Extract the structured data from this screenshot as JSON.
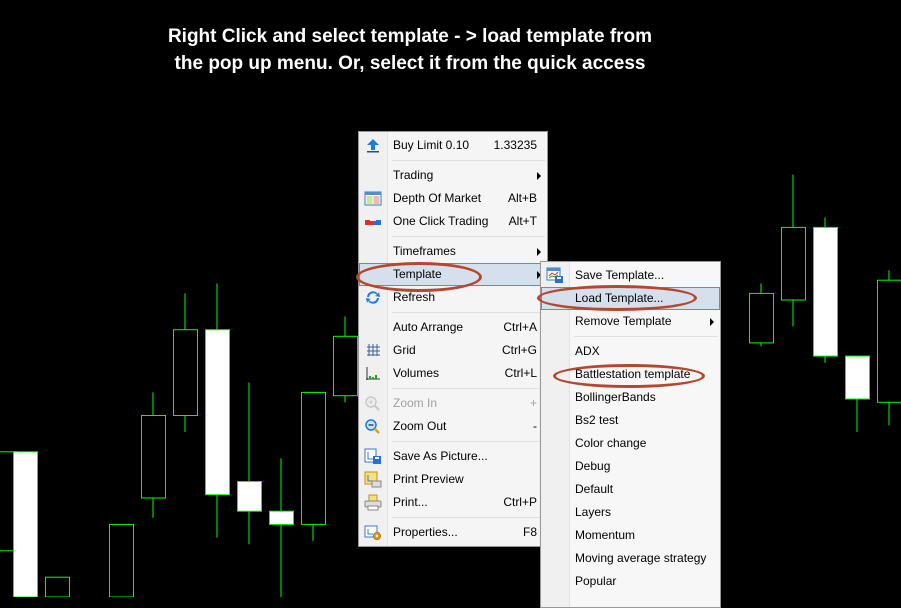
{
  "caption": {
    "line1": "Right Click and select template - > load template from",
    "line2": "the pop up menu. Or, select it from the quick access"
  },
  "colors": {
    "background": "#000000",
    "candle_outline": "#00ff00",
    "bull_fill": "#000000",
    "bear_fill": "#ffffff",
    "highlight_ellipse": "#b5472e",
    "menu_highlight": "#d5e0ec"
  },
  "chart_data": {
    "type": "candlestick",
    "title": "",
    "note": "Price values are relative (no axis shown); y in relative units, higher = higher price",
    "candles": [
      {
        "o": 44,
        "c": 14,
        "h": 44,
        "l": 14,
        "kind": "bull"
      },
      {
        "o": 44,
        "c": 0,
        "h": 44,
        "l": 0,
        "kind": "bear"
      },
      {
        "o": 6,
        "c": 0,
        "h": 6,
        "l": 0,
        "kind": "bull"
      },
      {
        "o": 22,
        "c": 0,
        "h": 22,
        "l": 0,
        "kind": "bull"
      },
      {
        "o": 55,
        "c": 30,
        "h": 62,
        "l": 24,
        "kind": "bull"
      },
      {
        "o": 81,
        "c": 55,
        "h": 92,
        "l": 50,
        "kind": "bull"
      },
      {
        "o": 81,
        "c": 31,
        "h": 95,
        "l": 18,
        "kind": "bear"
      },
      {
        "o": 35,
        "c": 26,
        "h": 65,
        "l": 16,
        "kind": "bear"
      },
      {
        "o": 26,
        "c": 22,
        "h": 42,
        "l": 0,
        "kind": "bear"
      },
      {
        "o": 62,
        "c": 22,
        "h": 62,
        "l": 17,
        "kind": "bull"
      },
      {
        "o": 79,
        "c": 61,
        "h": 85,
        "l": 59,
        "kind": "bull"
      },
      {
        "o": 85,
        "c": 74,
        "h": 89,
        "l": 71,
        "kind": "bull"
      },
      {
        "o": 93,
        "c": 72,
        "h": 98,
        "l": 69,
        "kind": "bull"
      },
      {
        "o": 72,
        "c": 60,
        "h": 73,
        "l": 57,
        "kind": "bull"
      },
      {
        "o": 92,
        "c": 77,
        "h": 95,
        "l": 76,
        "kind": "bull"
      },
      {
        "o": 112,
        "c": 90,
        "h": 128,
        "l": 82,
        "kind": "bull"
      },
      {
        "o": 112,
        "c": 73,
        "h": 115,
        "l": 71,
        "kind": "bear"
      },
      {
        "o": 73,
        "c": 60,
        "h": 73,
        "l": 50,
        "kind": "bear"
      },
      {
        "o": 96,
        "c": 59,
        "h": 99,
        "l": 52,
        "kind": "bull"
      }
    ]
  },
  "main_menu": {
    "items": [
      {
        "type": "item",
        "icon": "buy-limit-up-arrow-icon",
        "label": "Buy Limit 0.10",
        "shortcut": "1.33235"
      },
      {
        "type": "sep"
      },
      {
        "type": "item",
        "icon": "",
        "label": "Trading",
        "submenu": true
      },
      {
        "type": "item",
        "icon": "depth-of-market-icon",
        "label": "Depth Of Market",
        "shortcut": "Alt+B"
      },
      {
        "type": "item",
        "icon": "one-click-trading-icon",
        "label": "One Click Trading",
        "shortcut": "Alt+T"
      },
      {
        "type": "sep"
      },
      {
        "type": "item",
        "icon": "",
        "label": "Timeframes",
        "submenu": true
      },
      {
        "type": "item",
        "icon": "",
        "label": "Template",
        "submenu": true,
        "highlighted": true
      },
      {
        "type": "item",
        "icon": "refresh-icon",
        "label": "Refresh"
      },
      {
        "type": "sep"
      },
      {
        "type": "item",
        "icon": "",
        "label": "Auto Arrange",
        "shortcut": "Ctrl+A"
      },
      {
        "type": "item",
        "icon": "grid-icon",
        "label": "Grid",
        "shortcut": "Ctrl+G"
      },
      {
        "type": "item",
        "icon": "volumes-icon",
        "label": "Volumes",
        "shortcut": "Ctrl+L"
      },
      {
        "type": "sep"
      },
      {
        "type": "item",
        "icon": "zoom-in-icon",
        "label": "Zoom In",
        "shortcut": "+",
        "disabled": true
      },
      {
        "type": "item",
        "icon": "zoom-out-icon",
        "label": "Zoom Out",
        "shortcut": "-"
      },
      {
        "type": "sep"
      },
      {
        "type": "item",
        "icon": "save-as-picture-icon",
        "label": "Save As Picture..."
      },
      {
        "type": "item",
        "icon": "print-preview-icon",
        "label": "Print Preview"
      },
      {
        "type": "item",
        "icon": "print-icon",
        "label": "Print...",
        "shortcut": "Ctrl+P"
      },
      {
        "type": "sep"
      },
      {
        "type": "item",
        "icon": "properties-icon",
        "label": "Properties...",
        "shortcut": "F8"
      }
    ]
  },
  "template_submenu": {
    "items": [
      {
        "type": "item",
        "icon": "save-template-icon",
        "label": "Save Template..."
      },
      {
        "type": "item",
        "icon": "",
        "label": "Load Template...",
        "highlighted": true
      },
      {
        "type": "item",
        "icon": "",
        "label": "Remove Template",
        "submenu": true
      },
      {
        "type": "sep"
      },
      {
        "type": "item",
        "label": "ADX"
      },
      {
        "type": "item",
        "label": "Battlestation template"
      },
      {
        "type": "item",
        "label": "BollingerBands"
      },
      {
        "type": "item",
        "label": "Bs2 test"
      },
      {
        "type": "item",
        "label": "Color change"
      },
      {
        "type": "item",
        "label": "Debug"
      },
      {
        "type": "item",
        "label": "Default"
      },
      {
        "type": "item",
        "label": "Layers"
      },
      {
        "type": "item",
        "label": "Momentum"
      },
      {
        "type": "item",
        "label": "Moving average strategy"
      },
      {
        "type": "item",
        "label": "Popular"
      }
    ]
  }
}
